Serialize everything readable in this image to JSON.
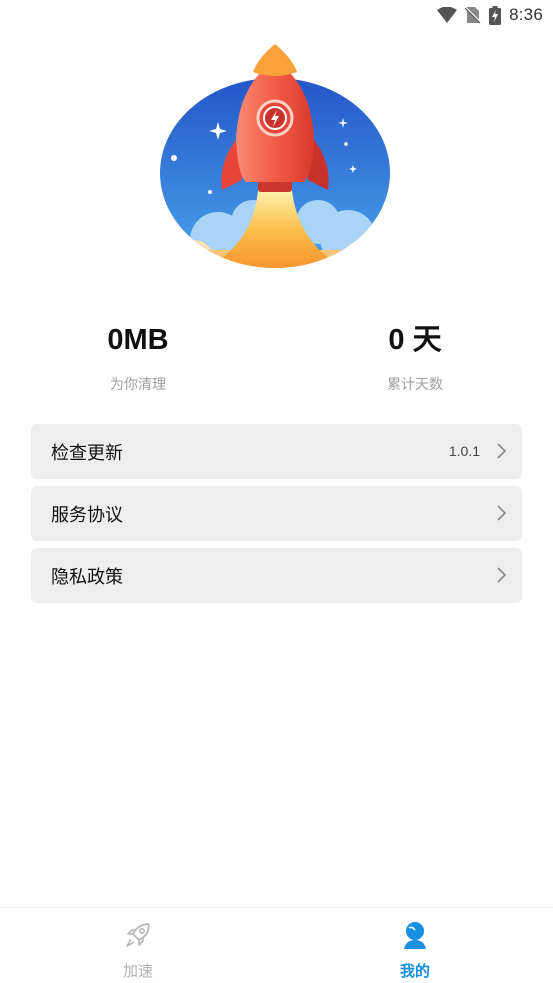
{
  "status_bar": {
    "time": "8:36",
    "icons": [
      "wifi-icon",
      "no-sim-icon",
      "battery-charging-icon"
    ]
  },
  "hero": {
    "icon": "rocket-illustration"
  },
  "stats": [
    {
      "value": "0MB",
      "label": "为你清理"
    },
    {
      "value": "0 天",
      "label": "累计天数"
    }
  ],
  "menu": {
    "check_update": {
      "label": "检查更新",
      "value": "1.0.1"
    },
    "service_agreement": {
      "label": "服务协议"
    },
    "privacy_policy": {
      "label": "隐私政策"
    }
  },
  "tabbar": {
    "tabs": [
      {
        "label": "加速",
        "icon": "rocket-icon",
        "active": false
      },
      {
        "label": "我的",
        "icon": "user-icon",
        "active": true
      }
    ]
  },
  "colors": {
    "accent": "#1790e0",
    "rocket": "#f0503c",
    "sky": "#2f78d8",
    "flame": "#f9a23a"
  }
}
